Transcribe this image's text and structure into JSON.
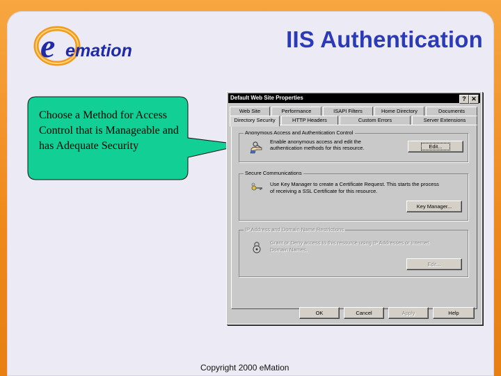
{
  "slide": {
    "title": "IIS Authentication",
    "logo_text": "emation",
    "callout": "Choose a Method for Access Control that is Manageable and has Adequate Security",
    "copyright": "Copyright 2000 eMation",
    "colors": {
      "orange": "#f08a1c",
      "title_blue": "#2b3bb8",
      "callout_green": "#0fcf96"
    }
  },
  "dialog": {
    "title": "Default Web Site Properties",
    "help_button": "?",
    "close_button": "✕",
    "tabs_back": [
      "Web Site",
      "Performance",
      "ISAPI Filters",
      "Home Directory",
      "Documents"
    ],
    "tabs_front": [
      "Directory Security",
      "HTTP Headers",
      "Custom Errors",
      "Server Extensions"
    ],
    "groups": {
      "anon": {
        "label": "Anonymous Access and Authentication Control",
        "text1": "Enable anonymous access and edit the",
        "text2": "authentication methods for this resource.",
        "button": "Edit...",
        "icon": "key-hand-icon"
      },
      "secure": {
        "label": "Secure Communications",
        "text1": "Use Key Manager to create a Certificate Request. This starts the process",
        "text2": "of receiving a SSL Certificate for this resource.",
        "button": "Key Manager...",
        "icon": "keys-icon"
      },
      "ip": {
        "label": "IP Address and Domain Name Restrictions",
        "text1": "Grant or Deny access to this resource using IP Addresses or Internet",
        "text2": "Domain Names.",
        "button": "Edit...",
        "icon": "lock-icon"
      }
    },
    "buttons": {
      "ok": "OK",
      "cancel": "Cancel",
      "apply": "Apply",
      "help": "Help"
    }
  }
}
